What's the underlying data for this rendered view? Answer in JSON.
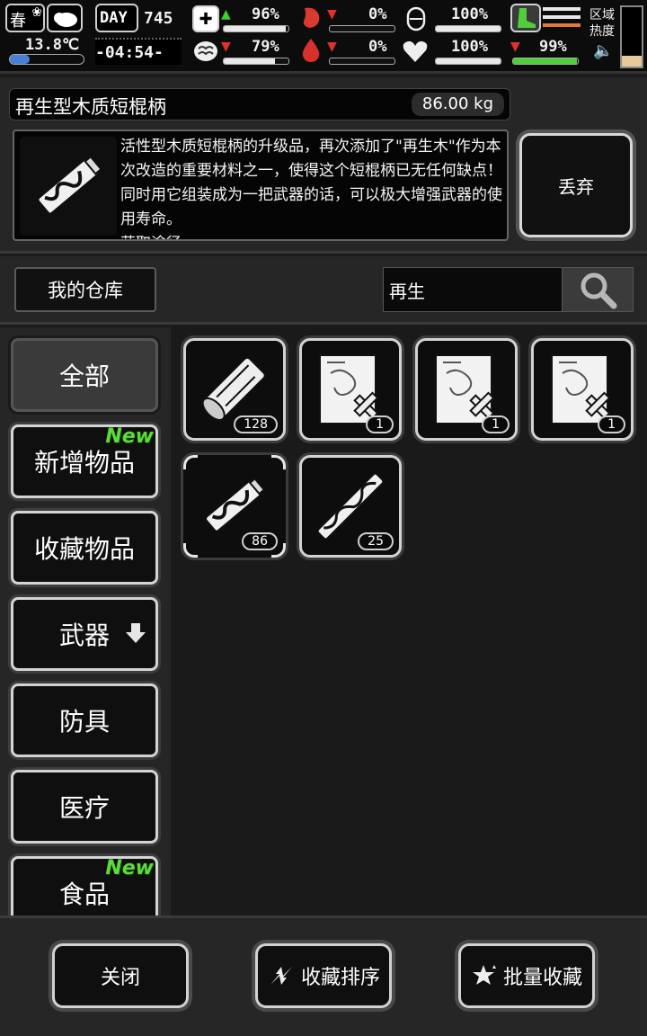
{
  "status": {
    "season": "春",
    "temperature": "13.8℃",
    "day_label": "DAY",
    "day_number": "745",
    "clock": "-04:54-",
    "health_pct": "96%",
    "health_trend": "up",
    "hunger_pct": "0%",
    "hunger_trend": "down",
    "stamina_pct": "100%",
    "sanity_pct": "79%",
    "sanity_trend": "down",
    "thirst_pct": "0%",
    "thirst_trend": "down",
    "mood_pct": "100%",
    "energy_pct": "99%",
    "energy_trend": "down",
    "region_label": "区域\n热度",
    "bars": {
      "health": 0.96,
      "hunger": 0.0,
      "stamina": 1.0,
      "sanity": 0.79,
      "thirst": 0.0,
      "mood": 1.0,
      "energy": 0.99
    },
    "icons": [
      "leaf-icon",
      "weather-icon",
      "medkit-icon",
      "stomach-icon",
      "stamina-icon",
      "brain-icon",
      "water-drop-icon",
      "heart-icon",
      "boot-icon",
      "speaker-icon"
    ]
  },
  "item_detail": {
    "name": "再生型木质短棍柄",
    "weight": "86.00 kg",
    "description": "活性型木质短棍柄的升级品，再次添加了\"再生木\"作为本次改造的重要材料之一，使得这个短棍柄已无任何缺点！同时用它组装成为一把武器的话，可以极大增强武器的使用寿命。",
    "description_cutoff": "获取途径",
    "discard_label": "丢弃"
  },
  "warehouse": {
    "tab_label": "我的仓库",
    "search_value": "再生",
    "search_icon": "search-icon"
  },
  "categories": [
    {
      "label": "全部",
      "active": true,
      "new": false
    },
    {
      "label": "新增物品",
      "active": false,
      "new": true
    },
    {
      "label": "收藏物品",
      "active": false,
      "new": false
    },
    {
      "label": "武器",
      "active": false,
      "new": false,
      "has_arrow": true
    },
    {
      "label": "防具",
      "active": false,
      "new": false
    },
    {
      "label": "医疗",
      "active": false,
      "new": false
    },
    {
      "label": "食品",
      "active": false,
      "new": true
    }
  ],
  "new_badge": "New",
  "items": [
    {
      "icon": "wood-log-icon",
      "count": "128"
    },
    {
      "icon": "blueprint-icon",
      "count": "1"
    },
    {
      "icon": "blueprint-icon",
      "count": "1"
    },
    {
      "icon": "blueprint-icon",
      "count": "1"
    },
    {
      "icon": "short-handle-icon",
      "count": "86",
      "selected": true
    },
    {
      "icon": "long-handle-icon",
      "count": "25"
    }
  ],
  "footer": {
    "close_label": "关闭",
    "sort_label": "收藏排序",
    "batch_label": "批量收藏"
  }
}
